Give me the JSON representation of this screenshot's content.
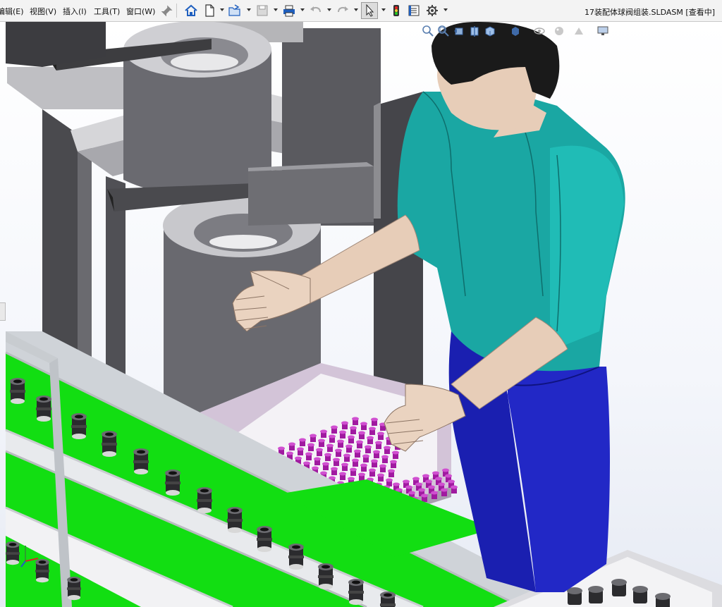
{
  "menu": {
    "items": [
      {
        "id": "edit",
        "label": "编辑(E)"
      },
      {
        "id": "view",
        "label": "视图(V)"
      },
      {
        "id": "insert",
        "label": "插入(I)"
      },
      {
        "id": "tools",
        "label": "工具(T)"
      },
      {
        "id": "window",
        "label": "窗口(W)"
      }
    ],
    "pin_icon": "pin-icon"
  },
  "toolbar": {
    "buttons": [
      {
        "id": "home",
        "icon": "home-icon"
      },
      {
        "id": "new",
        "icon": "new-document-icon",
        "dropdown": true
      },
      {
        "id": "open",
        "icon": "open-folder-icon",
        "dropdown": true
      },
      {
        "id": "save",
        "icon": "save-icon",
        "dropdown": true
      },
      {
        "id": "print",
        "icon": "print-icon",
        "dropdown": true
      },
      {
        "id": "undo",
        "icon": "undo-icon",
        "dropdown": true
      },
      {
        "id": "redo",
        "icon": "redo-icon",
        "dropdown": true
      },
      {
        "id": "select",
        "icon": "select-arrow-icon",
        "dropdown": true,
        "active": true
      },
      {
        "id": "rebuild",
        "icon": "traffic-light-icon"
      },
      {
        "id": "file-properties",
        "icon": "file-properties-icon"
      },
      {
        "id": "options",
        "icon": "gear-icon",
        "dropdown": true
      }
    ]
  },
  "document": {
    "title": "17装配体球阀组装.SLDASM [查看中]"
  },
  "heads_up_toolbar": {
    "buttons": [
      {
        "id": "zoom-to-fit",
        "icon": "zoom-to-fit-icon"
      },
      {
        "id": "zoom-to-area",
        "icon": "zoom-to-area-icon"
      },
      {
        "id": "previous-view",
        "icon": "previous-view-icon"
      },
      {
        "id": "section-view",
        "icon": "section-view-icon"
      },
      {
        "id": "view-orientation",
        "icon": "view-orientation-icon"
      },
      {
        "id": "display-style",
        "icon": "display-style-icon"
      },
      {
        "id": "hide-show",
        "icon": "hide-show-icon"
      },
      {
        "id": "edit-appearance",
        "icon": "edit-appearance-icon"
      },
      {
        "id": "apply-scene",
        "icon": "apply-scene-icon"
      },
      {
        "id": "view-settings",
        "icon": "monitor-icon"
      }
    ]
  },
  "colors": {
    "accent": "#1f5fbf",
    "conveyor_green": "#11dd11",
    "shirt": "#1aa7a3",
    "pants": "#1a1fb0",
    "skin": "#e7cdb8",
    "hair": "#1a1a1a",
    "tray": "#d9c9de",
    "parts_magenta": "#a01aa0",
    "machine_gray": "#5c5c60"
  }
}
